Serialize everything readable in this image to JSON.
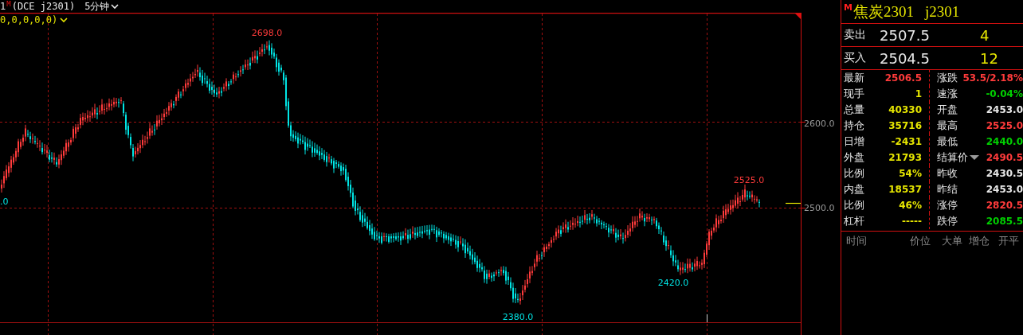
{
  "header": {
    "period_index": "1",
    "market_mark": "M",
    "contract": "(DCE j2301)",
    "interval": "5分钟"
  },
  "indicator": {
    "params": "0,0,0,0,0)"
  },
  "chart": {
    "left_edge_label": ".0",
    "price_labels": [
      {
        "text": "2698.0",
        "kind": "high"
      },
      {
        "text": "2525.0",
        "kind": "high"
      },
      {
        "text": "2420.0",
        "kind": "low"
      },
      {
        "text": "2380.0",
        "kind": "low"
      }
    ],
    "axis_labels": [
      "2600.0",
      "2500.0"
    ]
  },
  "quote": {
    "mark": "M",
    "name": "焦炭2301",
    "code": "j2301"
  },
  "book": [
    {
      "label": "卖出",
      "price": "2507.5",
      "volume": "4"
    },
    {
      "label": "买入",
      "price": "2504.5",
      "volume": "12"
    }
  ],
  "stats": [
    {
      "left": {
        "label": "最新",
        "value": "2506.5",
        "color": "#ff3b3b"
      },
      "right": {
        "label": "涨跌",
        "value": "53.5/2.18%",
        "color": "#ff3b3b",
        "dropdown": false
      }
    },
    {
      "left": {
        "label": "现手",
        "value": "1",
        "color": "#e6e600"
      },
      "right": {
        "label": "速涨",
        "value": "-0.04%",
        "color": "#00d000",
        "dropdown": false
      }
    },
    {
      "left": {
        "label": "总量",
        "value": "40330",
        "color": "#e6e600"
      },
      "right": {
        "label": "开盘",
        "value": "2453.0",
        "color": "#e8e8e8",
        "dropdown": false
      }
    },
    {
      "left": {
        "label": "持仓",
        "value": "35716",
        "color": "#e6e600"
      },
      "right": {
        "label": "最高",
        "value": "2525.0",
        "color": "#ff3b3b",
        "dropdown": false
      }
    },
    {
      "left": {
        "label": "日增",
        "value": "-2431",
        "color": "#e6e600"
      },
      "right": {
        "label": "最低",
        "value": "2440.0",
        "color": "#00d000",
        "dropdown": false
      }
    },
    {
      "left": {
        "label": "外盘",
        "value": "21793",
        "color": "#e6e600"
      },
      "right": {
        "label": "结算价",
        "value": "2490.5",
        "color": "#ff3b3b",
        "dropdown": true
      }
    },
    {
      "left": {
        "label": "比例",
        "value": "54%",
        "color": "#e6e600"
      },
      "right": {
        "label": "昨收",
        "value": "2430.5",
        "color": "#e8e8e8",
        "dropdown": false
      }
    },
    {
      "left": {
        "label": "内盘",
        "value": "18537",
        "color": "#e6e600"
      },
      "right": {
        "label": "昨结",
        "value": "2453.0",
        "color": "#e8e8e8",
        "dropdown": false
      }
    },
    {
      "left": {
        "label": "比例",
        "value": "46%",
        "color": "#e6e600"
      },
      "right": {
        "label": "涨停",
        "value": "2820.5",
        "color": "#ff3b3b",
        "dropdown": false
      }
    },
    {
      "left": {
        "label": "杠杆",
        "value": "-----",
        "color": "#e6e600"
      },
      "right": {
        "label": "跌停",
        "value": "2085.5",
        "color": "#00d000",
        "dropdown": false
      }
    }
  ],
  "ticks_header": [
    "时间",
    "价位",
    "大单",
    "增仓",
    "开平"
  ]
}
